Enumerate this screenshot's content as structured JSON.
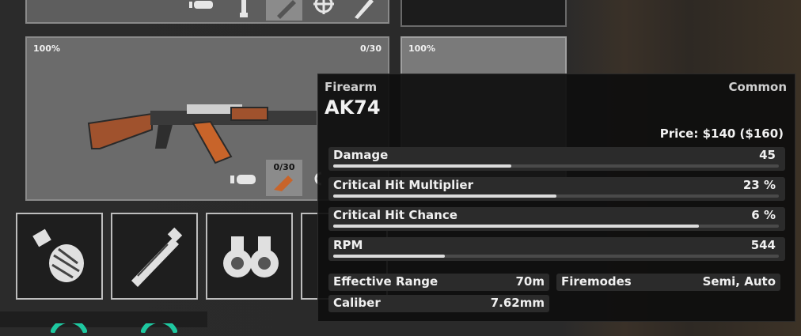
{
  "weapon_slot": {
    "durability": "100%",
    "ammo": "0/30",
    "magazine_ammo": "0/30"
  },
  "secondary_slot": {
    "durability": "100%"
  },
  "quick_slots": [
    {
      "icon": "grenade-icon"
    },
    {
      "icon": "flashlight-icon"
    },
    {
      "icon": "binoculars-icon"
    },
    {
      "icon": "empty-slot"
    }
  ],
  "tooltip": {
    "category": "Firearm",
    "rarity": "Common",
    "name": "AK74",
    "price": "Price: $140 ($160)",
    "stats": [
      {
        "label": "Damage",
        "value": "45",
        "fill": 0.4
      },
      {
        "label": "Critical Hit Multiplier",
        "value": "23 %",
        "fill": 0.5
      },
      {
        "label": "Critical Hit Chance",
        "value": "6 %",
        "fill": 0.82
      },
      {
        "label": "RPM",
        "value": "544",
        "fill": 0.25
      }
    ],
    "info": {
      "effective_range_label": "Effective Range",
      "effective_range_value": "70m",
      "firemodes_label": "Firemodes",
      "firemodes_value": "Semi, Auto",
      "caliber_label": "Caliber",
      "caliber_value": "7.62mm"
    }
  },
  "colors": {
    "wood": "#a0522d",
    "magazine": "#c8642a",
    "accent_green": "#1ec8a0"
  }
}
